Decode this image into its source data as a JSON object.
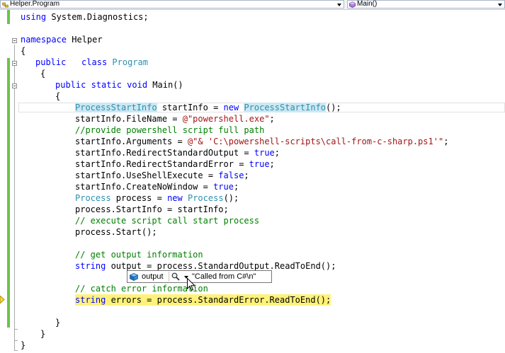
{
  "navbar": {
    "class_dropdown": {
      "value": "Helper.Program",
      "icon": "class-icon"
    },
    "member_dropdown": {
      "value": "Main()",
      "icon": "method-icon"
    }
  },
  "code": {
    "l1": {
      "kw": "using",
      "rest": " System.Diagnostics;"
    },
    "l3": {
      "kw": "namespace",
      "rest": " Helper"
    },
    "l4": {
      "text": "{"
    },
    "l5": {
      "kw1": "public",
      "kw2": "class",
      "type": "Program"
    },
    "l6": {
      "text": "{"
    },
    "l7": {
      "kw": "public static void",
      "rest": " Main()"
    },
    "l8": {
      "text": "{"
    },
    "l9": {
      "type1": "ProcessStartInfo",
      "mid": " startInfo = ",
      "kw": "new",
      "type2": "ProcessStartInfo",
      "end": "();"
    },
    "l10": {
      "pre": "startInfo.FileName = ",
      "str": "@\"powershell.exe\"",
      "end": ";"
    },
    "l11": {
      "comment": "//provide powershell script full path"
    },
    "l12": {
      "pre": "startInfo.Arguments = ",
      "str": "@\"& 'C:\\powershell-scripts\\call-from-c-sharp.ps1'\"",
      "end": ";"
    },
    "l13": {
      "pre": "startInfo.RedirectStandardOutput = ",
      "kw": "true",
      "end": ";"
    },
    "l14": {
      "pre": "startInfo.RedirectStandardError = ",
      "kw": "true",
      "end": ";"
    },
    "l15": {
      "pre": "startInfo.UseShellExecute = ",
      "kw": "false",
      "end": ";"
    },
    "l16": {
      "pre": "startInfo.CreateNoWindow = ",
      "kw": "true",
      "end": ";"
    },
    "l17": {
      "type1": "Process",
      "mid": " process = ",
      "kw": "new",
      "type2": "Process",
      "end": "();"
    },
    "l18": {
      "text": "process.StartInfo = startInfo;"
    },
    "l19": {
      "comment": "// execute script call start process"
    },
    "l20": {
      "text": "process.Start();"
    },
    "l22": {
      "comment": "// get output information"
    },
    "l23": {
      "kw": "string",
      "rest": " output = process.StandardOutput.ReadToEnd();"
    },
    "l25": {
      "comment": "// catch error information"
    },
    "l26": {
      "kw": "string",
      "rest": " errors = process.StandardError.ReadToEnd();"
    },
    "l28": {
      "text": "}"
    },
    "l29": {
      "text": "}"
    },
    "l30": {
      "text": "}"
    }
  },
  "datatip": {
    "icon": "object-icon",
    "name": "output",
    "magnifier_icon": "magnifier-icon",
    "dropdown_icon": "chevron-down-icon",
    "value": "\"Called from C#\\n\""
  },
  "colors": {
    "keyword": "#0000ff",
    "type": "#2b91af",
    "string": "#a31515",
    "comment": "#008000",
    "execution_highlight": "#fff27a",
    "change_bar": "#6cc24a"
  }
}
